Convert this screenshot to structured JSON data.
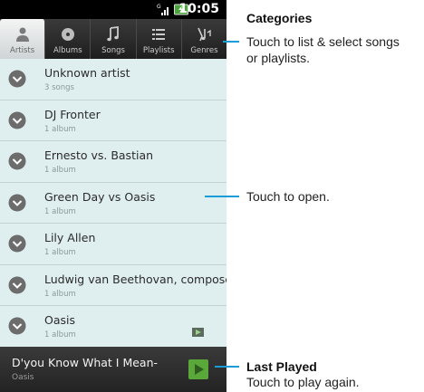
{
  "status_bar": {
    "time": "10:05",
    "network": "G"
  },
  "tabs": [
    {
      "label": "Artists",
      "icon": "artist-icon",
      "active": true
    },
    {
      "label": "Albums",
      "icon": "album-icon",
      "active": false
    },
    {
      "label": "Songs",
      "icon": "music-note-icon",
      "active": false
    },
    {
      "label": "Playlists",
      "icon": "playlist-icon",
      "active": false
    },
    {
      "label": "Genres",
      "icon": "genres-icon",
      "active": false
    }
  ],
  "list": [
    {
      "title": "Unknown artist",
      "subtitle": "3 songs"
    },
    {
      "title": "DJ Fronter",
      "subtitle": "1 album"
    },
    {
      "title": "Ernesto vs. Bastian",
      "subtitle": "1 album"
    },
    {
      "title": "Green Day vs Oasis",
      "subtitle": "1 album"
    },
    {
      "title": "Lily Allen",
      "subtitle": "1 album"
    },
    {
      "title": "Ludwig van Beethovan, composer.",
      "subtitle": "1 album"
    },
    {
      "title": "Oasis",
      "subtitle": "1 album"
    }
  ],
  "now_playing": {
    "title": "D'you Know What I Mean-",
    "artist": "Oasis"
  },
  "callouts": {
    "categories_title": "Categories",
    "categories_text_1": "Touch to list & select songs",
    "categories_text_2": "or playlists.",
    "open_text": "Touch to open.",
    "last_played_title": "Last Played",
    "last_played_text": "Touch to play again."
  },
  "colors": {
    "accent": "#1a9cd8",
    "list_background": "#dfeeef",
    "play_green": "#5aa83a"
  }
}
